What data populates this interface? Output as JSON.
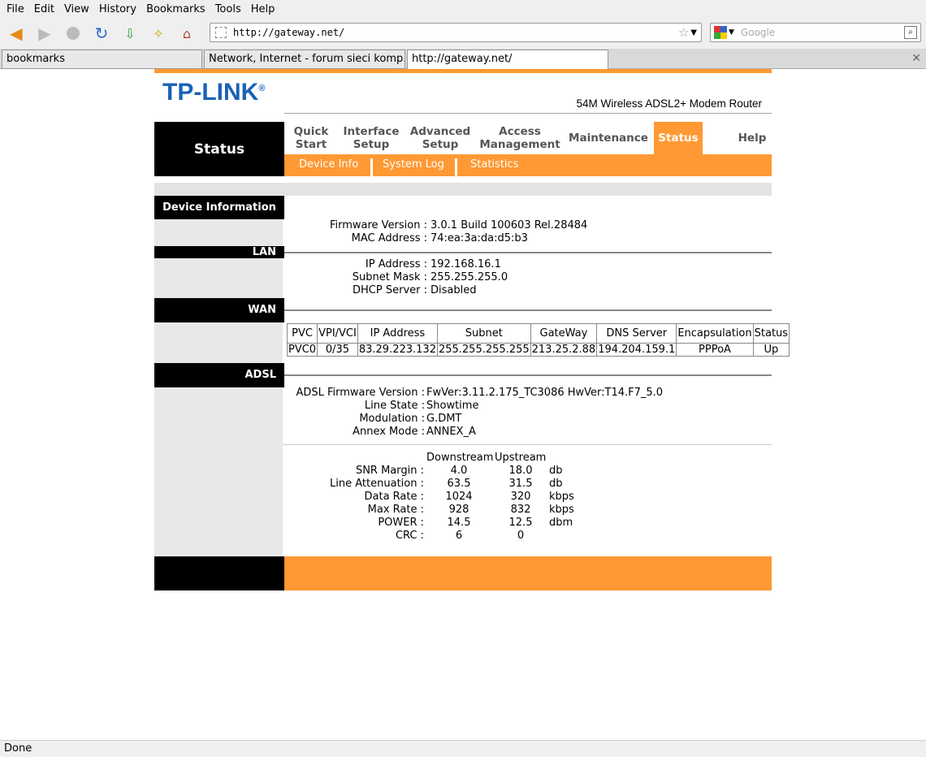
{
  "menu": [
    "File",
    "Edit",
    "View",
    "History",
    "Bookmarks",
    "Tools",
    "Help"
  ],
  "url": "http://gateway.net/",
  "search_placeholder": "Google",
  "tabs": [
    "bookmarks",
    "Network, Internet - forum sieci komp...",
    "http://gateway.net/"
  ],
  "router": {
    "logo": "TP-LINK",
    "logo_mark": "®",
    "model": "54M Wireless ADSL2+ Modem Router",
    "left_title": "Status",
    "nav": [
      {
        "l1": "Quick",
        "l2": "Start"
      },
      {
        "l1": "Interface",
        "l2": "Setup"
      },
      {
        "l1": "Advanced",
        "l2": "Setup"
      },
      {
        "l1": "Access",
        "l2": "Management"
      },
      {
        "l1": "Maintenance",
        "l2": ""
      },
      {
        "l1": "Status",
        "l2": ""
      },
      {
        "l1": "Help",
        "l2": ""
      }
    ],
    "subnav": [
      "Device Info",
      "System Log",
      "Statistics"
    ],
    "sections": {
      "device": "Device Information",
      "lan": "LAN",
      "wan": "WAN",
      "adsl": "ADSL"
    },
    "device": {
      "fw_label": "Firmware Version :",
      "fw": "3.0.1 Build 100603 Rel.28484",
      "mac_label": "MAC Address :",
      "mac": "74:ea:3a:da:d5:b3"
    },
    "lan": {
      "ip_label": "IP Address :",
      "ip": "192.168.16.1",
      "mask_label": "Subnet Mask :",
      "mask": "255.255.255.0",
      "dhcp_label": "DHCP Server :",
      "dhcp": "Disabled"
    },
    "wan": {
      "headers": [
        "PVC",
        "VPI/VCI",
        "IP Address",
        "Subnet",
        "GateWay",
        "DNS Server",
        "Encapsulation",
        "Status"
      ],
      "row": [
        "PVC0",
        "0/35",
        "83.29.223.132",
        "255.255.255.255",
        "213.25.2.88",
        "194.204.159.1",
        "PPPoA",
        "Up"
      ]
    },
    "adsl": {
      "fw_label": "ADSL Firmware Version :",
      "fw": "FwVer:3.11.2.175_TC3086 HwVer:T14.F7_5.0",
      "state_label": "Line State :",
      "state": "Showtime",
      "mod_label": "Modulation :",
      "mod": "G.DMT",
      "annex_label": "Annex Mode :",
      "annex": "ANNEX_A",
      "downstream": "Downstream",
      "upstream": "Upstream",
      "stats": [
        {
          "label": "SNR Margin :",
          "down": "4.0",
          "up": "18.0",
          "unit": "db"
        },
        {
          "label": "Line Attenuation :",
          "down": "63.5",
          "up": "31.5",
          "unit": "db"
        },
        {
          "label": "Data Rate :",
          "down": "1024",
          "up": "320",
          "unit": "kbps"
        },
        {
          "label": "Max Rate :",
          "down": "928",
          "up": "832",
          "unit": "kbps"
        },
        {
          "label": "POWER :",
          "down": "14.5",
          "up": "12.5",
          "unit": "dbm"
        },
        {
          "label": "CRC :",
          "down": "6",
          "up": "0",
          "unit": ""
        }
      ]
    }
  },
  "status_text": "Done"
}
